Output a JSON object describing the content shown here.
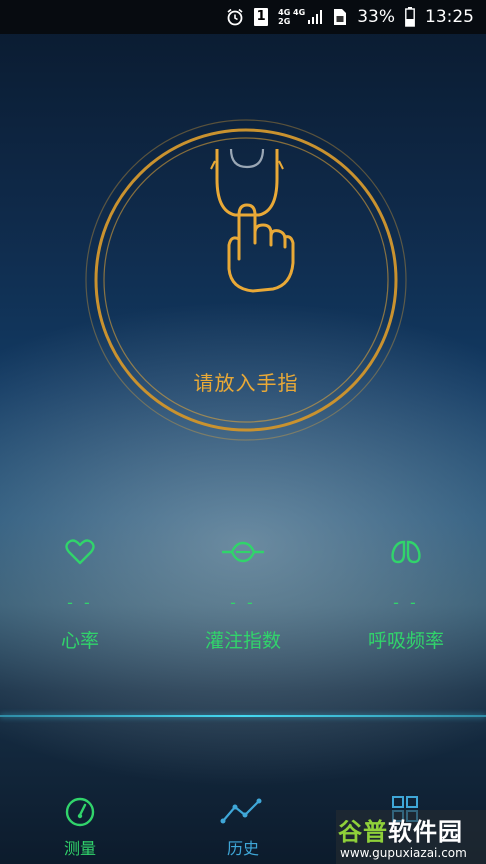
{
  "status_bar": {
    "sim_slot": "1",
    "network_top": "4G 4G",
    "network_bottom": "2G",
    "battery_percent": "33%",
    "time": "13:25"
  },
  "measure": {
    "prompt": "请放入手指"
  },
  "metrics": [
    {
      "value": "- -",
      "label": "心率",
      "icon": "heart-icon"
    },
    {
      "value": "- -",
      "label": "灌注指数",
      "icon": "perfusion-icon"
    },
    {
      "value": "- -",
      "label": "呼吸频率",
      "icon": "lungs-icon"
    }
  ],
  "bottom_nav": [
    {
      "label": "测量",
      "icon": "gauge-icon",
      "active": true
    },
    {
      "label": "历史",
      "icon": "trend-line-icon",
      "active": false
    },
    {
      "label": "",
      "icon": "grid-icon",
      "active": false
    }
  ],
  "watermark": {
    "title_a": "谷普",
    "title_b": "软件园",
    "url": "www.gupuxiazai.com"
  },
  "colors": {
    "accent_orange": "#e9a937",
    "accent_green": "#31d46b",
    "accent_blue": "#3fa7d8"
  }
}
